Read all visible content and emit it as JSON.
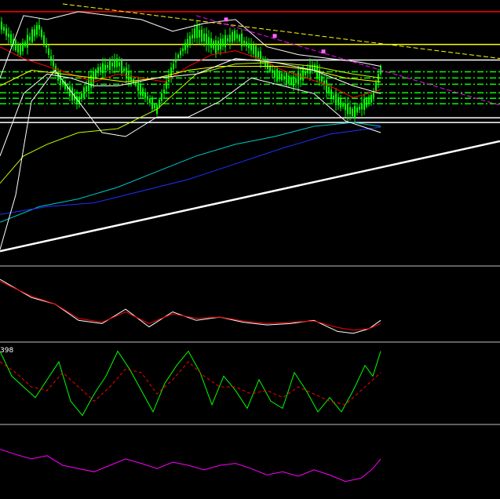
{
  "chart_data": [
    {
      "type": "candlestick",
      "panel": "price",
      "y_range": [
        0,
        340
      ],
      "colors": {
        "bull": "#00ff00",
        "bear": "#00ff00",
        "wick": "#00ff00"
      },
      "levels": [
        {
          "name": "red-level",
          "y": 15,
          "color": "#ff0000",
          "style": "solid"
        },
        {
          "name": "yellow-level",
          "y": 57,
          "color": "#ffff00",
          "style": "solid"
        },
        {
          "name": "white-level-1",
          "y": 77,
          "color": "#ffffff",
          "style": "solid"
        },
        {
          "name": "white-level-2",
          "y": 151,
          "color": "#ffffff",
          "style": "solid"
        },
        {
          "name": "white-level-3",
          "y": 157,
          "color": "#ffffff",
          "style": "solid"
        },
        {
          "name": "green-dash-1",
          "y": 92,
          "color": "#00ff00",
          "style": "dashdot"
        },
        {
          "name": "green-dash-2",
          "y": 100,
          "color": "#00ff00",
          "style": "dashdot"
        },
        {
          "name": "green-dash-3",
          "y": 108,
          "color": "#00ff00",
          "style": "dashdot"
        },
        {
          "name": "green-dash-4",
          "y": 119,
          "color": "#00ff00",
          "style": "dashdot"
        },
        {
          "name": "green-dash-5",
          "y": 126,
          "color": "#00ff00",
          "style": "dashdot"
        },
        {
          "name": "green-dash-6",
          "y": 133,
          "color": "#00ff00",
          "style": "dashdot"
        }
      ],
      "series": [
        {
          "name": "close",
          "color": "#00ff00",
          "x": [
            0,
            25,
            50,
            75,
            100,
            125,
            150,
            175,
            200,
            225,
            250,
            275,
            300,
            325,
            350,
            375,
            400,
            425,
            450,
            475,
            485
          ],
          "y": [
            30,
            65,
            35,
            100,
            130,
            90,
            80,
            110,
            140,
            75,
            40,
            60,
            45,
            65,
            95,
            105,
            85,
            125,
            145,
            125,
            90
          ]
        },
        {
          "name": "ma-fast",
          "color": "#ff0000",
          "x": [
            0,
            30,
            60,
            90,
            120,
            150,
            180,
            210,
            240,
            270,
            300,
            330,
            360,
            390,
            420,
            450,
            485
          ],
          "y": [
            60,
            75,
            85,
            95,
            105,
            95,
            100,
            105,
            85,
            70,
            65,
            75,
            90,
            100,
            110,
            125,
            115
          ]
        },
        {
          "name": "ma-yellow",
          "color": "#ffff00",
          "x": [
            0,
            40,
            80,
            120,
            160,
            200,
            240,
            280,
            320,
            360,
            400,
            440,
            485
          ],
          "y": [
            110,
            90,
            95,
            100,
            105,
            100,
            90,
            85,
            85,
            85,
            90,
            100,
            105
          ]
        },
        {
          "name": "ma-long-green",
          "color": "#bfff00",
          "x": [
            0,
            30,
            60,
            100,
            150,
            200,
            250,
            300,
            350,
            400,
            450,
            485
          ],
          "y": [
            235,
            200,
            185,
            170,
            165,
            140,
            95,
            82,
            80,
            85,
            95,
            100
          ]
        },
        {
          "name": "ma-cyan",
          "color": "#00c8c8",
          "x": [
            0,
            50,
            100,
            150,
            200,
            250,
            300,
            350,
            400,
            450,
            485
          ],
          "y": [
            285,
            265,
            255,
            240,
            220,
            200,
            185,
            175,
            162,
            157,
            162
          ]
        },
        {
          "name": "ma-blue",
          "color": "#2030ff",
          "x": [
            0,
            60,
            120,
            180,
            240,
            300,
            360,
            420,
            485
          ],
          "y": [
            275,
            265,
            260,
            245,
            230,
            210,
            190,
            172,
            163
          ]
        },
        {
          "name": "bollinger-upper",
          "color": "#ffffff",
          "x": [
            0,
            30,
            60,
            100,
            140,
            180,
            220,
            260,
            300,
            340,
            380,
            420,
            460,
            485
          ],
          "y": [
            100,
            20,
            25,
            15,
            20,
            25,
            40,
            30,
            25,
            60,
            70,
            75,
            80,
            85
          ]
        },
        {
          "name": "bollinger-lower",
          "color": "#ffffff",
          "x": [
            0,
            20,
            40,
            70,
            100,
            130,
            160,
            200,
            240,
            280,
            320,
            360,
            400,
            440,
            470,
            485
          ],
          "y": [
            320,
            250,
            130,
            90,
            130,
            170,
            175,
            150,
            150,
            130,
            100,
            110,
            120,
            155,
            165,
            170
          ]
        },
        {
          "name": "bollinger-mid",
          "color": "#ffffff",
          "x": [
            0,
            30,
            60,
            90,
            120,
            150,
            200,
            250,
            300,
            350,
            400,
            450,
            485
          ],
          "y": [
            200,
            120,
            95,
            100,
            110,
            110,
            100,
            95,
            75,
            80,
            90,
            110,
            120
          ]
        }
      ],
      "trendlines": [
        {
          "name": "support-trendline",
          "color": "#ffffff",
          "x": [
            0,
            637
          ],
          "y": [
            322,
            181
          ],
          "width": 2.5
        },
        {
          "name": "upper-trendline",
          "color": "#ffff00",
          "x": [
            80,
            637
          ],
          "y": [
            5,
            75
          ],
          "width": 1
        },
        {
          "name": "magenta-trendline",
          "color": "#ff00ff",
          "x": [
            250,
            637
          ],
          "y": [
            20,
            135
          ],
          "width": 1
        }
      ],
      "markers": [
        {
          "name": "pivot-1",
          "x": 288,
          "y": 25,
          "color": "#ff66ff"
        },
        {
          "name": "pivot-2",
          "x": 350,
          "y": 46,
          "color": "#ff66ff"
        },
        {
          "name": "pivot-3",
          "x": 412,
          "y": 66,
          "color": "#ff66ff"
        }
      ]
    },
    {
      "type": "line",
      "panel": "oscillator-1",
      "y_range": [
        0,
        100
      ],
      "series": [
        {
          "name": "osc-white",
          "color": "#ffffff",
          "x": [
            0,
            40,
            70,
            100,
            130,
            160,
            190,
            220,
            250,
            280,
            310,
            340,
            370,
            400,
            430,
            450,
            470,
            485
          ],
          "y": [
            88,
            60,
            50,
            25,
            20,
            42,
            15,
            38,
            25,
            30,
            22,
            18,
            20,
            25,
            8,
            5,
            12,
            25
          ]
        },
        {
          "name": "osc-red",
          "color": "#ff0000",
          "x": [
            0,
            40,
            70,
            100,
            130,
            160,
            190,
            220,
            250,
            280,
            310,
            340,
            370,
            400,
            430,
            450,
            470,
            485
          ],
          "y": [
            85,
            62,
            50,
            28,
            22,
            38,
            20,
            35,
            28,
            30,
            24,
            20,
            22,
            24,
            14,
            10,
            12,
            20
          ]
        }
      ]
    },
    {
      "type": "line",
      "panel": "stochastic",
      "label": "398",
      "y_range": [
        0,
        100
      ],
      "series": [
        {
          "name": "stoch-main",
          "color": "#00ff00",
          "x": [
            0,
            15,
            30,
            45,
            60,
            75,
            90,
            105,
            120,
            135,
            150,
            165,
            180,
            195,
            210,
            225,
            240,
            255,
            270,
            285,
            300,
            315,
            330,
            345,
            360,
            375,
            390,
            405,
            420,
            435,
            450,
            465,
            475,
            485
          ],
          "y": [
            95,
            60,
            45,
            30,
            55,
            80,
            25,
            5,
            35,
            60,
            95,
            70,
            40,
            10,
            50,
            75,
            95,
            65,
            20,
            60,
            40,
            15,
            55,
            25,
            15,
            65,
            40,
            10,
            30,
            10,
            40,
            75,
            60,
            95
          ]
        },
        {
          "name": "stoch-signal",
          "color": "#ff0000",
          "x": [
            0,
            20,
            40,
            60,
            80,
            100,
            120,
            140,
            160,
            180,
            200,
            220,
            240,
            260,
            280,
            300,
            320,
            340,
            360,
            380,
            400,
            420,
            440,
            460,
            485
          ],
          "y": [
            80,
            65,
            45,
            40,
            65,
            45,
            25,
            45,
            70,
            65,
            35,
            55,
            80,
            60,
            45,
            45,
            35,
            40,
            30,
            45,
            35,
            25,
            20,
            40,
            65
          ]
        }
      ]
    },
    {
      "type": "line",
      "panel": "oscillator-3",
      "y_range": [
        0,
        100
      ],
      "series": [
        {
          "name": "osc-magenta",
          "color": "#ff00ff",
          "x": [
            0,
            20,
            40,
            60,
            80,
            100,
            120,
            140,
            160,
            180,
            200,
            220,
            240,
            260,
            280,
            300,
            320,
            340,
            360,
            380,
            400,
            420,
            440,
            460,
            475,
            485
          ],
          "y": [
            70,
            62,
            55,
            60,
            45,
            40,
            35,
            45,
            55,
            48,
            40,
            50,
            45,
            38,
            45,
            48,
            40,
            30,
            35,
            28,
            38,
            30,
            20,
            25,
            40,
            55
          ]
        }
      ]
    }
  ],
  "panels": {
    "price": {
      "label": ""
    },
    "oscillator-1": {
      "label": ""
    },
    "stochastic": {
      "label": "398"
    },
    "oscillator-3": {
      "label": ""
    }
  },
  "colors": {
    "background": "#000000",
    "separator": "#c0c0c0"
  }
}
